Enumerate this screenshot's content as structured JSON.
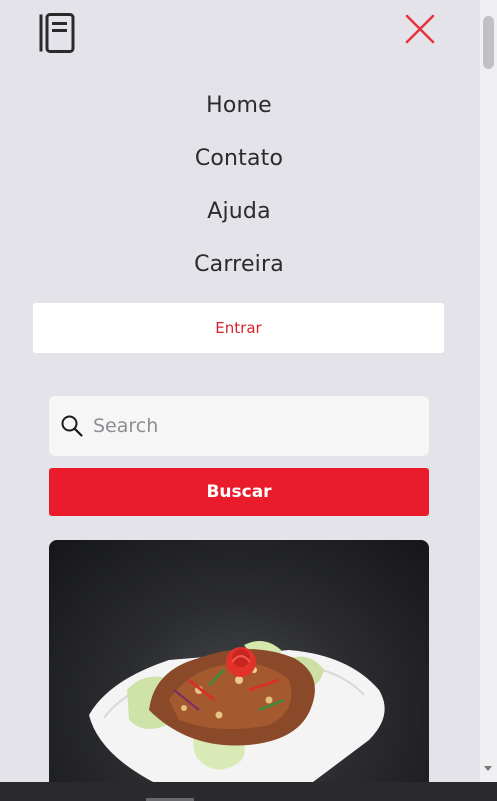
{
  "header": {
    "logo_icon": "notebook-icon",
    "close_icon": "close-icon",
    "close_color": "#e8333f"
  },
  "nav": {
    "items": [
      {
        "label": "Home"
      },
      {
        "label": "Contato"
      },
      {
        "label": "Ajuda"
      },
      {
        "label": "Carreira"
      }
    ]
  },
  "login": {
    "label": "Entrar",
    "color": "#d8232d"
  },
  "search": {
    "icon": "search-icon",
    "placeholder": "Search",
    "value": "",
    "button_label": "Buscar",
    "button_color": "#ea1c2c"
  },
  "card": {
    "image": "salad-dish-image"
  },
  "colors": {
    "background": "#e4e3ea",
    "accent": "#ea1c2c"
  }
}
